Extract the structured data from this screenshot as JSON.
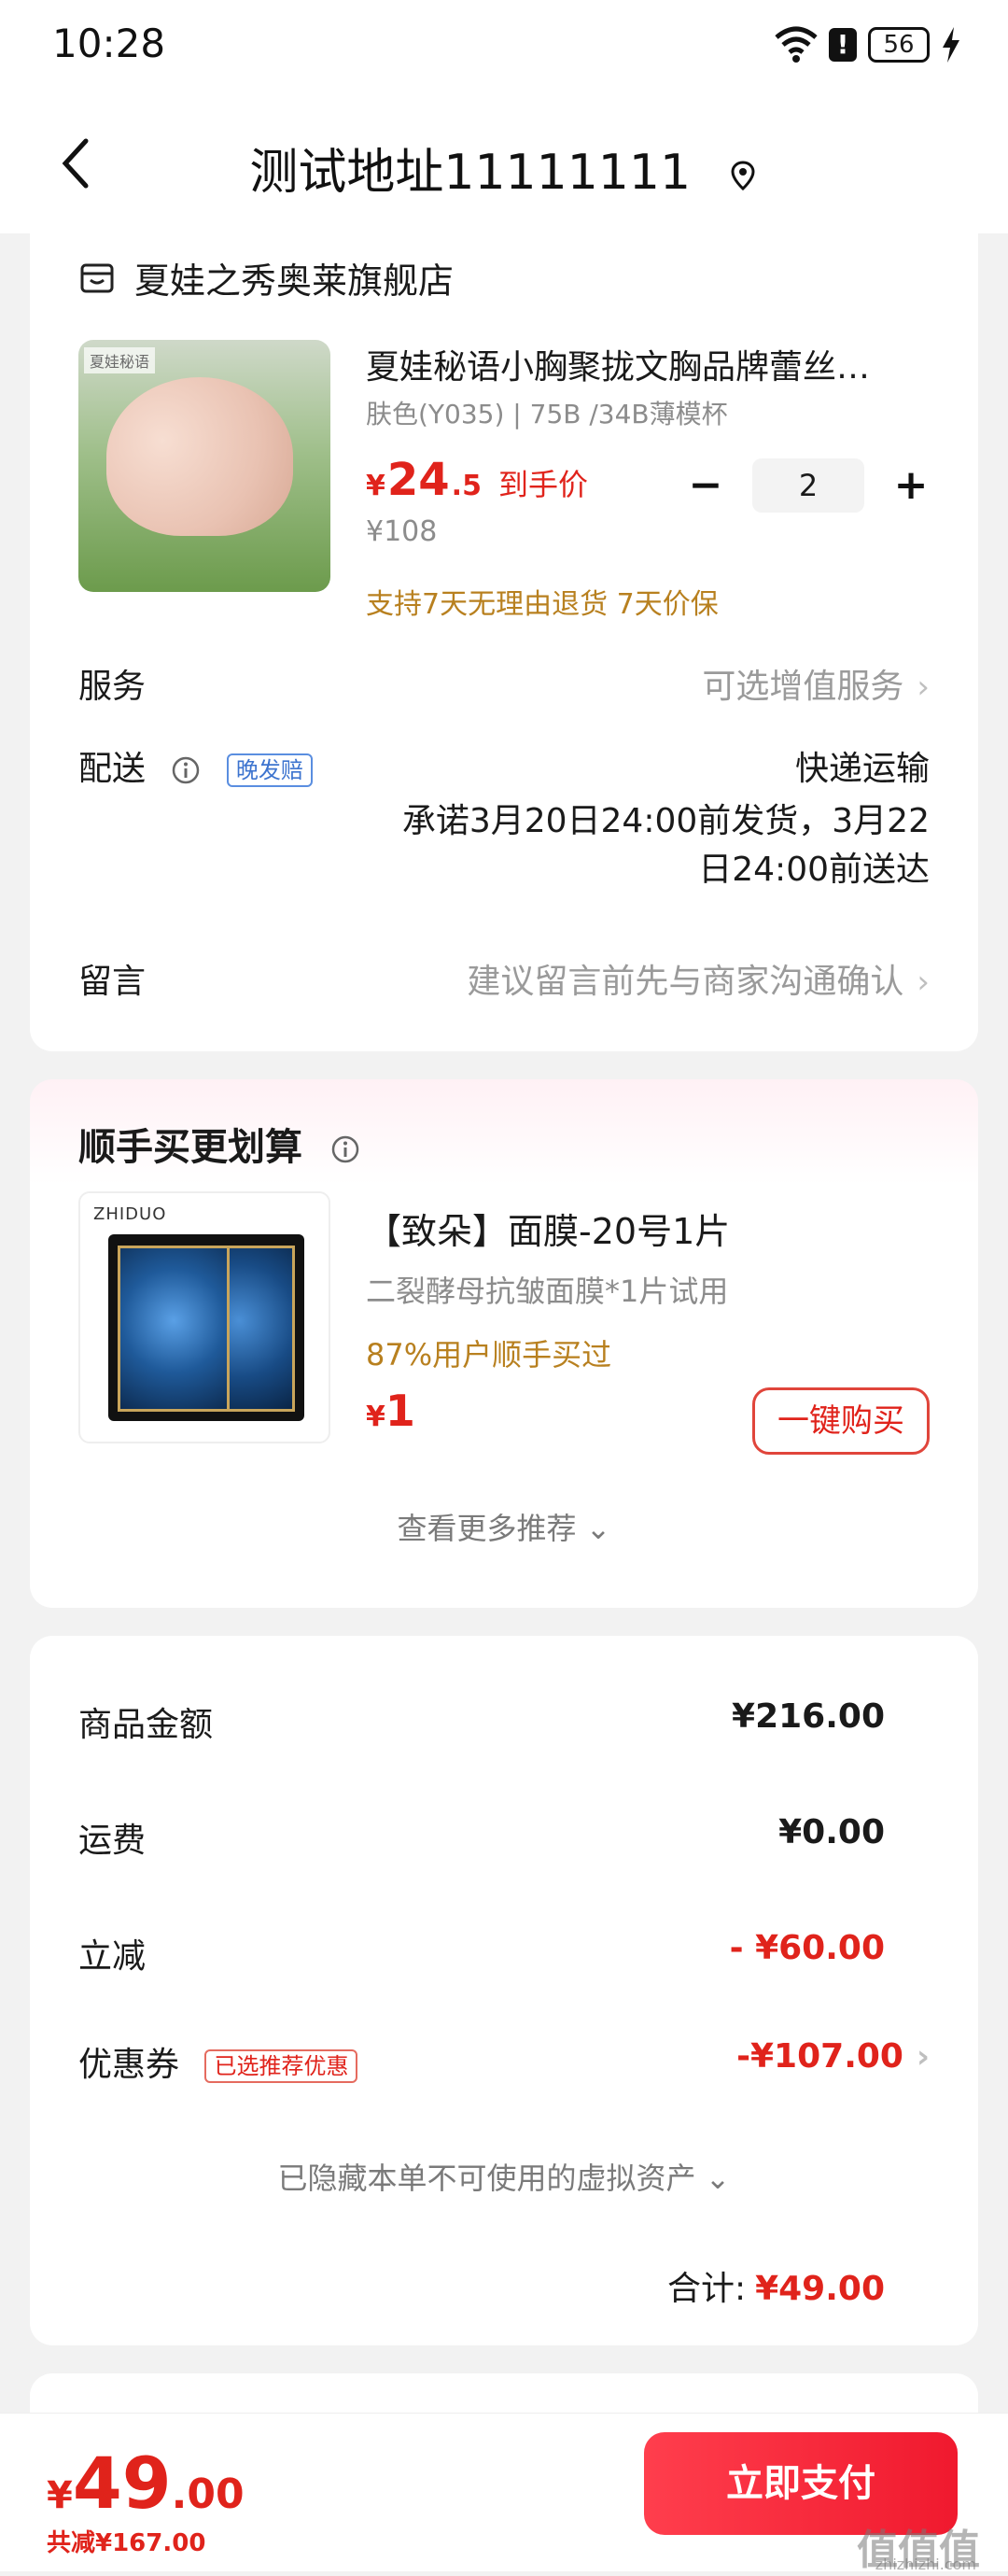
{
  "status_bar": {
    "time": "10:28",
    "battery": "56",
    "icons": [
      "wifi-icon",
      "alert-icon",
      "battery-icon",
      "charging-bolt-icon"
    ]
  },
  "nav": {
    "back_icon": "chevron-left-icon",
    "title": "测试地址11111111",
    "location_icon": "location-pin-icon"
  },
  "shop": {
    "icon": "store-icon",
    "name": "夏娃之秀奥莱旗舰店",
    "product": {
      "title": "夏娃秘语小胸聚拢文胸品牌蕾丝…",
      "spec": "肤色(Y035) | 75B /34B薄模杯",
      "price_symbol": "¥",
      "price_int": "24",
      "price_dec": ".5",
      "price_tag": "到手价",
      "original_price": "¥108",
      "quantity": "2",
      "minus_label": "−",
      "plus_label": "+",
      "promise": "支持7天无理由退货  7天价保",
      "image_brand": "夏娃秘语"
    },
    "service": {
      "label": "服务",
      "value": "可选增值服务"
    },
    "delivery": {
      "label": "配送",
      "badge": "晚发赔",
      "method": "快递运输",
      "promise_line1": "承诺3月20日24:00前发货，3月22",
      "promise_line2": "日24:00前送达"
    },
    "message": {
      "label": "留言",
      "placeholder": "建议留言前先与商家沟通确认"
    },
    "chevron": "›"
  },
  "addon": {
    "title": "顺手买更划算",
    "item": {
      "image_brand": "ZHIDUO",
      "name": "【致朵】面膜-20号1片",
      "desc": "二裂酵母抗皱面膜*1片试用",
      "stat": "87%用户顺手买过",
      "price_symbol": "¥",
      "price": "1",
      "buy_label": "一键购买"
    },
    "more": "查看更多推荐 ⌄"
  },
  "summary": {
    "rows": [
      {
        "label": "商品金额",
        "value": "¥216.00"
      },
      {
        "label": "运费",
        "value": "¥0.00"
      },
      {
        "label": "立减",
        "value": "- ¥60.00"
      },
      {
        "label": "优惠券",
        "badge": "已选推荐优惠",
        "value": "-¥107.00"
      }
    ],
    "hidden_assets": "已隐藏本单不可使用的虚拟资产 ⌄",
    "total_label": "合计:",
    "total_value": "¥49.00"
  },
  "bottom": {
    "price_symbol": "¥",
    "price_int": "49",
    "price_dec": ".00",
    "saved": "共减¥167.00",
    "pay_label": "立即支付",
    "watermark": "值值值",
    "watermark_url": "zhizhizhi.com"
  },
  "colors": {
    "accent_red": "#e0231b",
    "gold": "#b8801f",
    "pay_button": "#f0192e"
  }
}
